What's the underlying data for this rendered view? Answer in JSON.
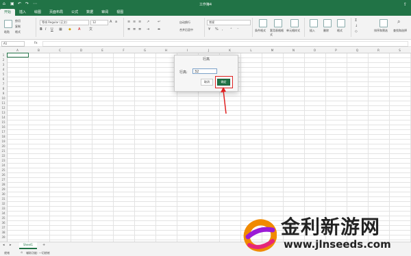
{
  "window": {
    "title": "工作簿4"
  },
  "ribbon_tabs": [
    "开始",
    "插入",
    "绘图",
    "页面布局",
    "公式",
    "数据",
    "审阅",
    "视图"
  ],
  "ribbon": {
    "paste": "粘贴",
    "cut": "剪切",
    "copy": "复制",
    "format_painter": "格式",
    "font_name": "等线 Regular (正文)",
    "font_size": "12",
    "wrap": "自动换行",
    "merge": "合并后居中",
    "number_format": "常规",
    "cond_format": "条件格式",
    "format_table": "套用表格格式",
    "cell_styles": "单元格样式",
    "insert": "插入",
    "delete": "删除",
    "format": "格式",
    "sort_filter": "排序和筛选",
    "find_select": "查找和选择"
  },
  "formula_bar": {
    "name_box": "A1",
    "fx": "fx"
  },
  "columns": [
    "A",
    "B",
    "C",
    "D",
    "E",
    "F",
    "G",
    "H",
    "I",
    "J",
    "K",
    "L",
    "M",
    "N",
    "O",
    "P",
    "Q",
    "R",
    "S"
  ],
  "rows": [
    "1",
    "2",
    "3",
    "4",
    "5",
    "6",
    "7",
    "8",
    "9",
    "10",
    "11",
    "12",
    "13",
    "14",
    "15",
    "16",
    "17",
    "18",
    "19",
    "20",
    "21",
    "22",
    "23",
    "24",
    "25",
    "26",
    "27",
    "28",
    "29",
    "30",
    "31",
    "32",
    "33",
    "34",
    "35",
    "36",
    "37",
    "38",
    "39"
  ],
  "sheet_tab": "Sheet1",
  "status": {
    "ready": "就绪",
    "accessibility": "辅助功能: 一切就绪"
  },
  "dialog": {
    "title": "行高",
    "label": "行高:",
    "value": "32",
    "cancel": "取消",
    "ok": "确定"
  },
  "watermark": {
    "brand": "金利新游网",
    "url": "www.jlnseeds.com"
  },
  "colors": {
    "excel_green": "#217346",
    "highlight_red": "#e02020"
  }
}
